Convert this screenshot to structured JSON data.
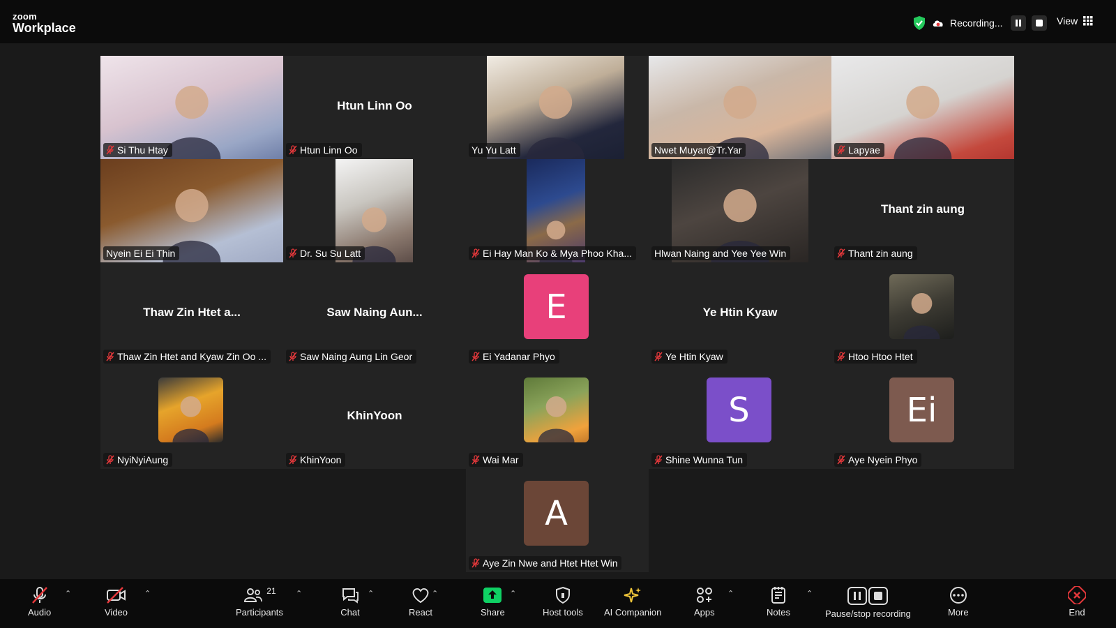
{
  "app": {
    "logo_small": "zoom",
    "logo_big": "Workplace"
  },
  "recording": {
    "label": "Recording...",
    "view_label": "View"
  },
  "participants": [
    {
      "name": "Si Thu Htay",
      "display": "photo",
      "muted": true,
      "active": false
    },
    {
      "name": "Htun Linn Oo",
      "display": "text",
      "center_text": "Htun Linn Oo",
      "muted": true,
      "active": false
    },
    {
      "name": "Yu Yu Latt",
      "display": "photo",
      "muted": false,
      "active": false
    },
    {
      "name": "Nwet Muyar@Tr.Yar",
      "display": "photo",
      "muted": false,
      "active": true
    },
    {
      "name": "Lapyae",
      "display": "photo",
      "muted": true,
      "active": false
    },
    {
      "name": "Nyein Ei Ei Thin",
      "display": "photo",
      "muted": false,
      "active": false
    },
    {
      "name": "Dr. Su Su Latt",
      "display": "photo",
      "muted": true,
      "active": false
    },
    {
      "name": "Ei Hay Man Ko & Mya Phoo Kha...",
      "display": "photo",
      "muted": true,
      "active": false
    },
    {
      "name": "Hlwan Naing and Yee Yee Win",
      "display": "photo",
      "muted": false,
      "active": false
    },
    {
      "name": "Thant zin aung",
      "display": "text",
      "center_text": "Thant zin aung",
      "muted": true,
      "active": false
    },
    {
      "name": "Thaw Zin Htet and Kyaw Zin Oo ...",
      "display": "text",
      "center_text": "Thaw Zin Htet a...",
      "muted": true,
      "active": false
    },
    {
      "name": "Saw Naing Aung Lin Geor",
      "display": "text",
      "center_text": "Saw Naing Aun...",
      "muted": true,
      "active": false
    },
    {
      "name": "Ei Yadanar Phyo",
      "display": "avatar",
      "avatar_letter": "E",
      "avatar_color": "#e8407a",
      "muted": true,
      "active": false
    },
    {
      "name": "Ye Htin Kyaw",
      "display": "text",
      "center_text": "Ye Htin Kyaw",
      "muted": true,
      "active": false
    },
    {
      "name": "Htoo Htoo Htet",
      "display": "photo",
      "muted": true,
      "active": false
    },
    {
      "name": "NyiNyiAung",
      "display": "photo",
      "muted": true,
      "active": false
    },
    {
      "name": "KhinYoon",
      "display": "text",
      "center_text": "KhinYoon",
      "muted": true,
      "active": false
    },
    {
      "name": "Wai Mar",
      "display": "photo",
      "muted": true,
      "active": false
    },
    {
      "name": "Shine Wunna Tun",
      "display": "avatar",
      "avatar_letter": "S",
      "avatar_color": "#7b4fc9",
      "muted": true,
      "active": false
    },
    {
      "name": "Aye Nyein Phyo",
      "display": "avatar",
      "avatar_letter": "Ei",
      "avatar_color": "#7d5a4f",
      "muted": true,
      "active": false
    },
    {
      "name": "Aye Zin Nwe and Htet Htet Win",
      "display": "avatar",
      "avatar_letter": "A",
      "avatar_color": "#6b4637",
      "muted": true,
      "active": false
    }
  ],
  "toolbar": {
    "audio": "Audio",
    "video": "Video",
    "participants": "Participants",
    "participants_count": "21",
    "chat": "Chat",
    "react": "React",
    "share": "Share",
    "host_tools": "Host tools",
    "ai_companion": "AI Companion",
    "apps": "Apps",
    "notes": "Notes",
    "pause_stop": "Pause/stop recording",
    "more": "More",
    "end": "End"
  },
  "colors": {
    "active_border": "#24c95c",
    "share_green": "#0fd164",
    "end_red": "#e5383b",
    "muted_red": "#e5383b"
  }
}
